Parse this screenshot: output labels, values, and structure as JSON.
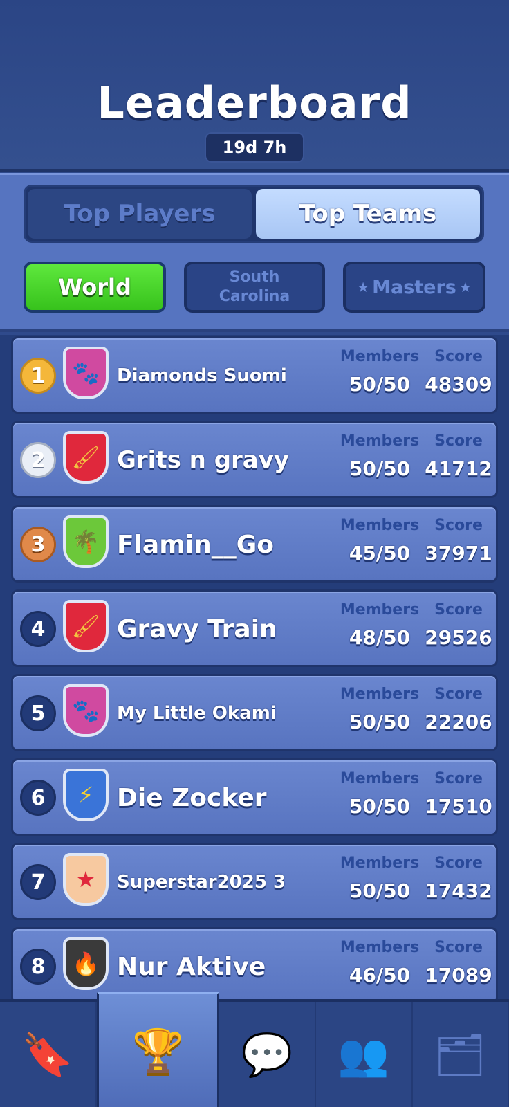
{
  "header": {
    "title": "Leaderboard",
    "timer": "19d 7h"
  },
  "tabs": [
    {
      "label": "Top Players",
      "active": false
    },
    {
      "label": "Top Teams",
      "active": true
    }
  ],
  "regions": {
    "world": "World",
    "south_carolina": "South Carolina",
    "masters": "Masters",
    "active": "World"
  },
  "columns": {
    "members": "Members",
    "score": "Score"
  },
  "teams": [
    {
      "rank": "1",
      "name": "Diamonds Suomi",
      "members": "50/50",
      "score": "48309",
      "icon": "paw-icon",
      "badge_color": "#d04aa0"
    },
    {
      "rank": "2",
      "name": "Grits n gravy",
      "members": "50/50",
      "score": "41712",
      "icon": "brush-icon",
      "badge_color": "#e0283c"
    },
    {
      "rank": "3",
      "name": "Flamin__Go",
      "members": "45/50",
      "score": "37971",
      "icon": "palm-tree-icon",
      "badge_color": "#6cc83a"
    },
    {
      "rank": "4",
      "name": "Gravy Train",
      "members": "48/50",
      "score": "29526",
      "icon": "brush-icon",
      "badge_color": "#e0283c"
    },
    {
      "rank": "5",
      "name": "My Little Okami",
      "members": "50/50",
      "score": "22206",
      "icon": "paw-icon",
      "badge_color": "#d04aa0"
    },
    {
      "rank": "6",
      "name": "Die Zocker",
      "members": "50/50",
      "score": "17510",
      "icon": "lightning-icon",
      "badge_color": "#3a74d8"
    },
    {
      "rank": "7",
      "name": "Superstar2025 3",
      "members": "50/50",
      "score": "17432",
      "icon": "star-icon",
      "badge_color": "#f7c9a0"
    },
    {
      "rank": "8",
      "name": "Nur Aktive",
      "members": "46/50",
      "score": "17089",
      "icon": "flame-icon",
      "badge_color": "#3a3a3a"
    }
  ],
  "nav": [
    {
      "name": "bookmark-box-icon",
      "active": false
    },
    {
      "name": "trophy-icon",
      "active": true
    },
    {
      "name": "chat-icon",
      "active": false
    },
    {
      "name": "team-icon",
      "active": false
    },
    {
      "name": "album-icon",
      "active": false
    }
  ]
}
